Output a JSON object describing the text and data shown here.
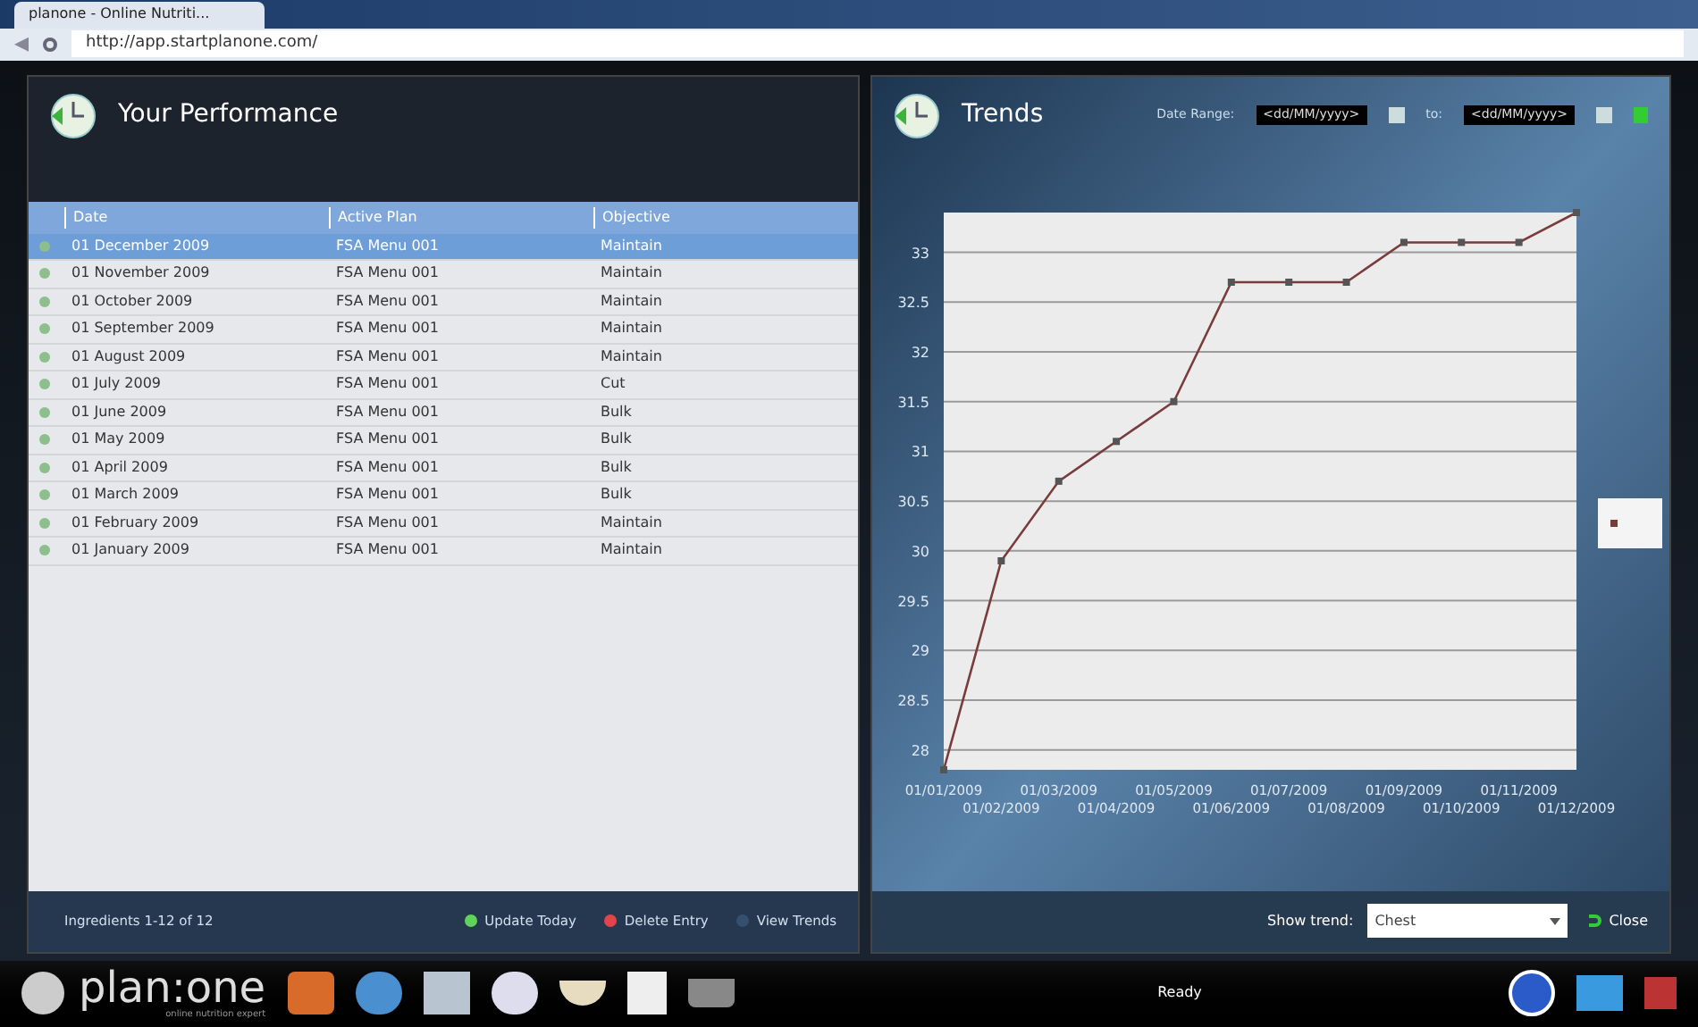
{
  "browser": {
    "tab": "planone - Online Nutriti...",
    "url": "http://app.startplanone.com/"
  },
  "performance": {
    "title": "Your Performance",
    "table": {
      "columns": [
        "Date",
        "Active Plan",
        "Objective"
      ],
      "rows": [
        {
          "cells": [
            "01 December 2009",
            "FSA Menu 001",
            "Maintain"
          ],
          "selected": true
        },
        {
          "cells": [
            "01 November 2009",
            "FSA Menu 001",
            "Maintain"
          ],
          "selected": false
        },
        {
          "cells": [
            "01 October 2009",
            "FSA Menu 001",
            "Maintain"
          ],
          "selected": false
        },
        {
          "cells": [
            "01 September 2009",
            "FSA Menu 001",
            "Maintain"
          ],
          "selected": false
        },
        {
          "cells": [
            "01 August 2009",
            "FSA Menu 001",
            "Maintain"
          ],
          "selected": false
        },
        {
          "cells": [
            "01 July 2009",
            "FSA Menu 001",
            "Cut"
          ],
          "selected": false
        },
        {
          "cells": [
            "01 June 2009",
            "FSA Menu 001",
            "Bulk"
          ],
          "selected": false
        },
        {
          "cells": [
            "01 May 2009",
            "FSA Menu 001",
            "Bulk"
          ],
          "selected": false
        },
        {
          "cells": [
            "01 April 2009",
            "FSA Menu 001",
            "Bulk"
          ],
          "selected": false
        },
        {
          "cells": [
            "01 March 2009",
            "FSA Menu 001",
            "Bulk"
          ],
          "selected": false
        },
        {
          "cells": [
            "01 February 2009",
            "FSA Menu 001",
            "Maintain"
          ],
          "selected": false
        },
        {
          "cells": [
            "01 January 2009",
            "FSA Menu 001",
            "Maintain"
          ],
          "selected": false
        }
      ]
    },
    "pager": "Ingredients 1-12 of 12",
    "actions": [
      {
        "label": "Update Today",
        "color": "#5fd35a"
      },
      {
        "label": "Delete Entry",
        "color": "#e0454a"
      },
      {
        "label": "View Trends",
        "color": "#35506e"
      }
    ]
  },
  "trends": {
    "title": "Trends",
    "date_range_label": "Date Range:",
    "from": "<dd/MM/yyyy>",
    "to_label": "to:",
    "to": "<dd/MM/yyyy>",
    "chart_data": {
      "type": "line",
      "categories": [
        "01/01/2009",
        "01/02/2009",
        "01/03/2009",
        "01/04/2009",
        "01/05/2009",
        "01/06/2009",
        "01/07/2009",
        "01/08/2009",
        "01/09/2009",
        "01/10/2009",
        "01/11/2009",
        "01/12/2009"
      ],
      "grid": true,
      "series": [
        {
          "color": "#7a3b3b",
          "marker": "square",
          "values": [
            27.8,
            29.9,
            30.7,
            31.1,
            31.5,
            32.7,
            32.7,
            32.7,
            33.1,
            33.1,
            33.1,
            33.4
          ]
        }
      ],
      "ylim": [
        27.8,
        33.4
      ],
      "yticks": [
        28,
        28.5,
        29,
        29.5,
        30,
        30.5,
        31,
        31.5,
        32,
        32.5,
        33
      ]
    },
    "show_trend_label": "Show trend:",
    "show_trend": "Chest",
    "close": "Close"
  },
  "taskbar": {
    "logo": "plan:one",
    "tagline": "online nutrition expert",
    "status": "Ready"
  }
}
